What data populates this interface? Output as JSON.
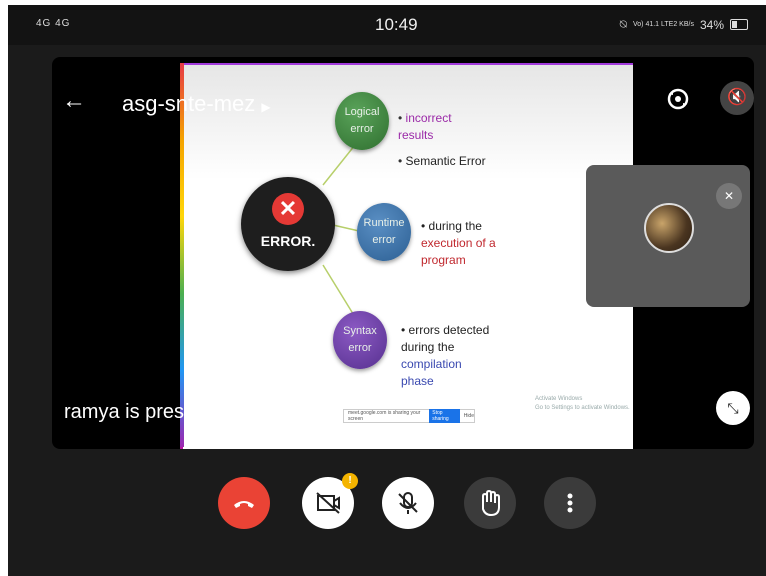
{
  "status_bar": {
    "left_icons": "4G 4G",
    "time": "10:49",
    "right_text": "Vo) 41.1 LTE2 KB/s",
    "battery": "34%"
  },
  "meeting": {
    "code": "asg-snte-mez",
    "presenter_text": "ramya is presenting"
  },
  "slide": {
    "center_label": "ERROR.",
    "nodes": [
      {
        "label": "Logical error"
      },
      {
        "label": "Runtime error"
      },
      {
        "label": "Syntax error"
      }
    ],
    "bullets": {
      "logical_1": "incorrect results",
      "logical_2": "Semantic Error",
      "runtime_prefix": "during the",
      "runtime_highlight": "execution of a program",
      "syntax_prefix": "errors detected during the",
      "syntax_highlight": "compilation phase"
    },
    "share_bar_text": "meet.google.com is sharing your screen",
    "share_stop": "Stop sharing",
    "share_hide": "Hide",
    "watermark_line1": "Activate Windows",
    "watermark_line2": "Go to Settings to activate Windows."
  },
  "controls": {
    "badge": "!"
  },
  "colors": {
    "end_call": "#ea4335",
    "badge": "#f4b400"
  }
}
